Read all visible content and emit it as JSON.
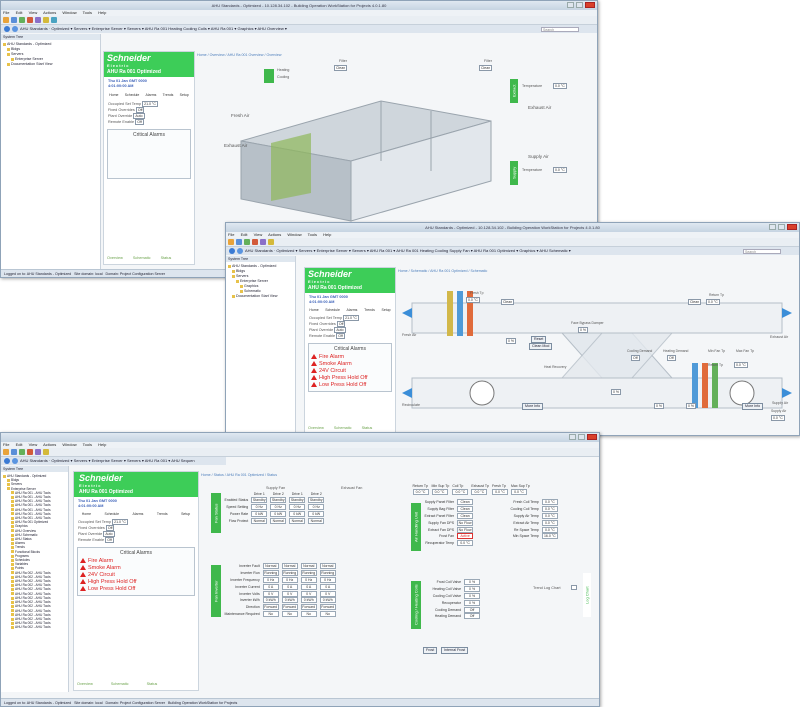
{
  "window1": {
    "title": "AHU Standards - Optimized - 10.128.34.102 - Building Operation WorkStation for Projects 4.0.1.80",
    "menu": [
      "File",
      "Edit",
      "View",
      "Actions",
      "Window",
      "Tools",
      "Help"
    ],
    "navpath": "AHU Standards · Optimized ▾ Servers ▾ Enterprise Server ▾ Servers ▾ AHU Ra 001 Heating Cooling Coils ▾ AHU Ra 001 ▾ Graphics ▾ AHU Overview ▾",
    "search_placeholder": "Search",
    "tree_header": "System Tree",
    "tree": [
      "AHU Standards - Optimized",
      "Bldgs",
      "Servers",
      "Enterprise Server",
      "Documentation Start View"
    ],
    "breadcrumb": "Home / Overview / AHU Ra 001 Overview / Overview",
    "logo_line1": "Schneider",
    "logo_line2": "Electric",
    "unit_name": "AHU Ra 001 Optimized",
    "date": "Thu 01 Jan GMT 0000",
    "time": "4:01:00:00 AM",
    "icons": [
      "Home",
      "Schedule",
      "Alarms",
      "Trends",
      "Setup"
    ],
    "setpoints": [
      {
        "label": "Occupied Set Temp",
        "value": "21.0 °C"
      },
      {
        "label": "Fixed Overrides",
        "value": "Off"
      },
      {
        "label": "Plant Override",
        "value": "Auto"
      },
      {
        "label": "Remote Enable",
        "value": "Off"
      }
    ],
    "alarms_title": "Critical Alarms",
    "bottom_tabs": [
      "Overview",
      "Schematic",
      "Status"
    ],
    "labels": {
      "heating": "Heating",
      "cooling": "Cooling",
      "fresh_air": "Fresh Air",
      "exhaust_air_left": "Exhaust Air",
      "exhaust_air_right": "Exhaust Air",
      "supply_air": "Supply Air",
      "filter1": "Filter",
      "filter1_state": "Clean",
      "filter2": "Filter",
      "filter2_state": "Clean",
      "filter3": "Filter",
      "filter3_state": "Clean",
      "temperature_top": "Temperature",
      "temperature_top_value": "0.0 °C",
      "temperature_bottom": "Temperature",
      "temperature_bottom_value": "0.0 °C",
      "extract": "Extract",
      "supply": "Supply"
    },
    "status_left": "Logged on to: AHU Standards - Optimized",
    "status_mid": "Site domain: local",
    "status_right": "Domain: Project Configuration Server"
  },
  "window2": {
    "title": "AHU Standards - Optimized - 10.128.34.102 - Building Operation WorkStation for Projects 4.0.1.80",
    "menu": [
      "File",
      "Edit",
      "View",
      "Actions",
      "Window",
      "Tools",
      "Help"
    ],
    "navpath": "AHU Standards · Optimized ▾ Servers ▾ Enterprise Server ▾ Servers ▾ AHU Ra 001 ▾ AHU Ra 001 Heating Cooling Supply Fan ▾ AHU Ra 001 Optimized ▾ Graphics ▾ AHU Schematic ▾",
    "search_placeholder": "Search",
    "tree_header": "System Tree",
    "tree": [
      "AHU Standards - Optimized",
      "Bldgs",
      "Servers",
      "Enterprise Server",
      "Graphics",
      "Schematic",
      "Documentation Start View"
    ],
    "breadcrumb": "Home / Schematic / AHU Ra 001 Optimized / Schematic",
    "unit_name": "AHU Ra 001 Optimized",
    "date": "Thu 01 Jan GMT 0000",
    "time": "4:01:00:00 AM",
    "icons": [
      "Home",
      "Schedule",
      "Alarms",
      "Trends",
      "Setup"
    ],
    "setpoints": [
      {
        "label": "Occupied Set Temp",
        "value": "21.0 °C"
      },
      {
        "label": "Fixed Overrides",
        "value": "Off"
      },
      {
        "label": "Plant Override",
        "value": "Auto"
      },
      {
        "label": "Remote Enable",
        "value": "Off"
      }
    ],
    "alarms_title": "Critical Alarms",
    "alarms": [
      "Fire Alarm",
      "Smoke Alarm",
      "24V Circuit",
      "High Press Hold Off",
      "Low Press Hold Off"
    ],
    "bottom_tabs": [
      "Overview",
      "Schematic",
      "Status"
    ],
    "labels": {
      "fresh_air": "Fresh Air",
      "exhaust_air": "Exhaust Air",
      "recirculate": "Recirculate",
      "supply_air": "Supply Air",
      "clean_l": "Clean",
      "clean_r": "Clean",
      "face_bypass": "Face Bypass Damper",
      "face_bypass_value": "0 %",
      "heat_recovery": "Heat Recovery",
      "cooling_demand": "Cooling Demand",
      "cooling_demand_value": "Off",
      "heating_demand": "Heating Demand",
      "heating_demand_value": "Off",
      "return_temp": "Return Tp",
      "return_temp_value": "0.0 °C",
      "return_temp2": "Return Tp",
      "return_temp2_value": "0.0 °C",
      "fresh_temp": "Fresh Tp",
      "fresh_temp_value": "0.0 °C",
      "min_fan_tp": "Min Fan Tp",
      "max_fan_tp": "Max Fan Tp",
      "v_pct_1": "0 %",
      "v_pct_2": "0 %",
      "v_pct_3": "0 %",
      "v_pct_4": "0 %",
      "reset": "Reset",
      "reset_state": "Clean Mod",
      "more_info_1": "More Info",
      "more_info_2": "More Info",
      "supply_demand": "Supply Air",
      "supply_demand_value": "0.0 °C"
    }
  },
  "window3": {
    "menu": [
      "File",
      "Edit",
      "View",
      "Actions",
      "Window",
      "Tools",
      "Help"
    ],
    "navpath": "AHU Standards · Optimized ▾ Servers ▾ Enterprise Server ▾ Servers ▾ AHU Ra 001 ▾ AHU Sequen",
    "tree_header": "System Tree",
    "tree": [
      "AHU Standards - Optimized",
      "Bldgs",
      "Servers",
      "Enterprise Server",
      "AHU Ra 001 - AHU Tools",
      "AHU Ra 001 - AHU Tools",
      "AHU Ra 001 - AHU Tools",
      "AHU Ra 001 - AHU Tools",
      "AHU Ra 001 - AHU Tools",
      "AHU Ra 001 - AHU Tools",
      "AHU Ra 001 - AHU Tools",
      "AHU Ra 001 Optimized",
      "Graphics",
      "AHU Overview",
      "AHU Schematic",
      "AHU Status",
      "Alarms",
      "Trends",
      "Functional Blocks",
      "Programs",
      "Schedules",
      "Variables",
      "Points",
      "AHU Ra 002 - AHU Tools",
      "AHU Ra 002 - AHU Tools",
      "AHU Ra 002 - AHU Tools",
      "AHU Ra 002 - AHU Tools",
      "AHU Ra 002 - AHU Tools",
      "AHU Ra 002 - AHU Tools",
      "AHU Ra 002 - AHU Tools",
      "AHU Ra 002 - AHU Tools",
      "AHU Ra 002 - AHU Tools",
      "AHU Ra 002 - AHU Tools",
      "AHU Ra 002 - AHU Tools",
      "AHU Ra 002 - AHU Tools",
      "AHU Ra 002 - AHU Tools",
      "AHU Ra 002 - AHU Tools"
    ],
    "breadcrumb": "Home / Status / AHU Ra 001 Optimized / Status",
    "unit_name": "AHU Ra 001 Optimized",
    "date": "Thu 01 Jan GMT 0000",
    "time": "4:01:00:00 AM",
    "icons": [
      "Home",
      "Schedule",
      "Alarms",
      "Trends",
      "Setup"
    ],
    "setpoints": [
      {
        "label": "Occupied Set Temp",
        "value": "21.0 °C"
      },
      {
        "label": "Fixed Overrides",
        "value": "Off"
      },
      {
        "label": "Plant Override",
        "value": "Auto"
      },
      {
        "label": "Remote Enable",
        "value": "Off"
      }
    ],
    "alarms_title": "Critical Alarms",
    "alarms": [
      "Fire Alarm",
      "Smoke Alarm",
      "24V Circuit",
      "High Press Hold Off",
      "Low Press Hold Off"
    ],
    "bottom_tabs": [
      "Overview",
      "Schematic",
      "Status"
    ],
    "fan_table": {
      "group_supply": "Supply Fan",
      "group_exhaust": "Exhaust Fan",
      "columns": [
        "Drive 1",
        "Drive 2",
        "Drive 1",
        "Drive 2"
      ],
      "rows": [
        {
          "label": "Enabled Status",
          "values": [
            "Standby",
            "Standby",
            "Standby",
            "Standby"
          ]
        },
        {
          "label": "Speed Setting",
          "values": [
            "0 Hz",
            "0 Hz",
            "0 Hz",
            "0 Hz"
          ]
        },
        {
          "label": "Power Rate",
          "values": [
            "0 kW",
            "0 kW",
            "0 kW",
            "0 kW"
          ]
        },
        {
          "label": "Flow Protect",
          "values": [
            "Normal",
            "Normal",
            "Normal",
            "Normal"
          ]
        }
      ]
    },
    "inverter_table": {
      "rows": [
        {
          "label": "Inverter Fault",
          "values": [
            "Normal",
            "Normal",
            "Normal",
            "Normal"
          ]
        },
        {
          "label": "Inverter Run",
          "values": [
            "Running",
            "Running",
            "Running",
            "Running"
          ]
        },
        {
          "label": "Inverter Frequency",
          "values": [
            "0 Hz",
            "0 Hz",
            "0 Hz",
            "0 Hz"
          ]
        },
        {
          "label": "Inverter Current",
          "values": [
            "0 A",
            "0 A",
            "0 A",
            "0 A"
          ]
        },
        {
          "label": "Inverter Volts",
          "values": [
            "0 V",
            "0 V",
            "0 V",
            "0 V"
          ]
        },
        {
          "label": "Inverter kWh",
          "values": [
            "0 kWh",
            "0 kWh",
            "0 kWh",
            "0 kWh"
          ]
        },
        {
          "label": "Direction",
          "values": [
            "Forward",
            "Forward",
            "Forward",
            "Forward"
          ]
        },
        {
          "label": "Maintenance Required",
          "values": [
            "No",
            "No",
            "No",
            "No"
          ]
        }
      ]
    },
    "fan_side_label": "Fan Status",
    "inverter_side_label": "Fan Inverter",
    "temps_top": [
      {
        "label": "Return Tp",
        "value": "0.0 °C"
      },
      {
        "label": "Min Sup Tp",
        "value": "0.0 °C"
      },
      {
        "label": "Coil Tp",
        "value": "0.0 °C"
      },
      {
        "label": "Exhaust Tp",
        "value": "0.0 °C"
      },
      {
        "label": "Fresh Tp",
        "value": "0.0 °C"
      },
      {
        "label": "Max Sup Tp",
        "value": "0.0 °C"
      }
    ],
    "filter_list": {
      "side": "Air Handling Unit",
      "rows": [
        {
          "label": "Supply Panel Filter",
          "value": "Clean"
        },
        {
          "label": "Supply Bag Filter",
          "value": "Clean"
        },
        {
          "label": "Extract Panel Filter",
          "value": "Clean"
        },
        {
          "label": "Supply Fan DPS",
          "value": "No Flow"
        },
        {
          "label": "Extract Fan DPS",
          "value": "No Flow"
        },
        {
          "label": "Frost Fan",
          "value": "Active"
        },
        {
          "label": "Recuperator Temp",
          "value": "0.0 °C"
        }
      ]
    },
    "right_list": {
      "rows": [
        {
          "label": "Fresh Coil Temp",
          "value": "0.0 °C"
        },
        {
          "label": "Cooling Coil Temp",
          "value": "0.0 °C"
        },
        {
          "label": "Supply Air Temp",
          "value": "0.0 °C"
        },
        {
          "label": "Extract Air Temp",
          "value": "0.0 °C"
        },
        {
          "label": "Re Space Temp",
          "value": "0.0 °C"
        },
        {
          "label": "Min Space Temp",
          "value": "16.0 °C"
        }
      ]
    },
    "coil_list": {
      "side": "Cooling / Heating Coils",
      "rows": [
        {
          "label": "Frost Coil Valve",
          "value": "0 %"
        },
        {
          "label": "Heating Coil Valve",
          "value": "0 %"
        },
        {
          "label": "Cooling Coil Valve",
          "value": "0 %"
        },
        {
          "label": "Recuperator",
          "value": "0 %"
        },
        {
          "label": "Cooling Demand",
          "value": "Off"
        },
        {
          "label": "Heating Demand",
          "value": "Off"
        }
      ]
    },
    "log_chart_label": "Trend Log Chart",
    "log_chart_side": "Log Chart",
    "btn_frost": "Frost",
    "btn_internal": "Internal Frost",
    "status_left": "Logged on to: AHU Standards - Optimized",
    "status_mid": "Site domain: local",
    "status_right": "Domain: Project Configuration Server",
    "task": "Building Operation WorkStation for Projects",
    "tab_label": "Status"
  },
  "colors": {
    "schneider_green": "#3dcd58",
    "alarm_red": "#dd2222",
    "link_blue": "#3a60b8"
  }
}
